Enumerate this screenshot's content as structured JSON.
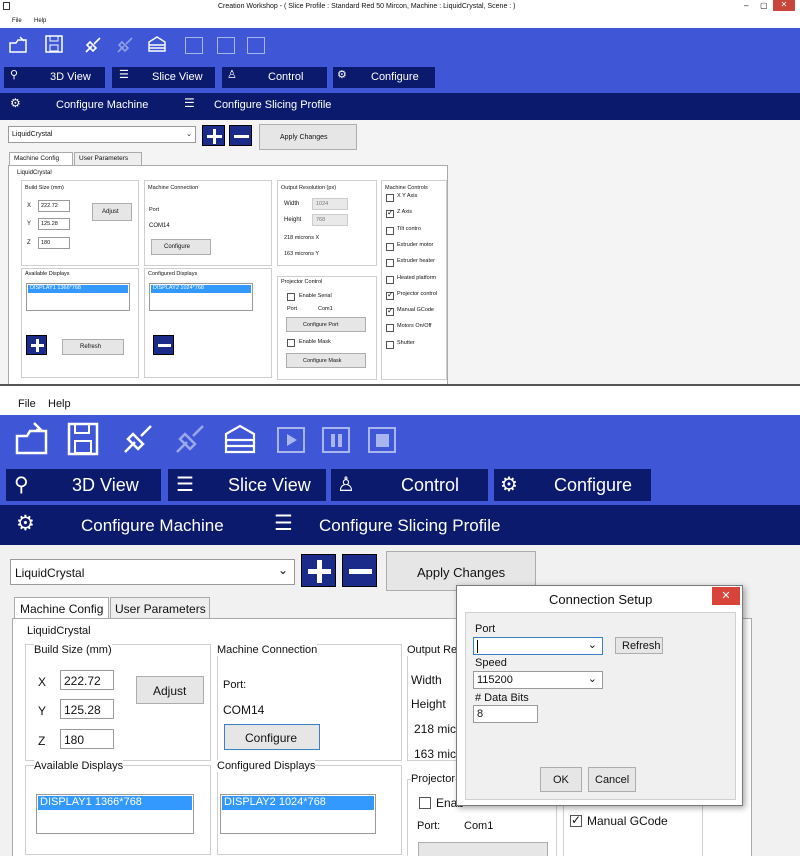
{
  "window": {
    "app_icon": "window-icon",
    "title": "Creation Workshop -  ( Slice Profile : Standard Red 50 Mircon, Machine : LiquidCrystal, Scene : )",
    "min": "–",
    "max": "▢",
    "close": "✕"
  },
  "menu": {
    "file": "File",
    "help": "Help"
  },
  "toolbar": {
    "icons": [
      "open-file-icon",
      "save-icon",
      "connect-icon",
      "disconnect-icon",
      "slice-icon",
      "play-icon",
      "pause-icon",
      "stop-icon"
    ]
  },
  "tabs": {
    "view3d": "3D View",
    "slice_view": "Slice View",
    "control": "Control",
    "configure": "Configure"
  },
  "subtabs": {
    "configure_machine": "Configure Machine",
    "configure_slicing": "Configure Slicing Profile"
  },
  "machine_select": {
    "value": "LiquidCrystal"
  },
  "apply_changes": "Apply Changes",
  "config_tabs": {
    "machine_config": "Machine Config",
    "user_parameters": "User Parameters"
  },
  "machine_name": "LiquidCrystal",
  "build_size": {
    "label": "Build Size (mm)",
    "x_label": "X",
    "x": "222.72",
    "y_label": "Y",
    "y": "125.28",
    "z_label": "Z",
    "z": "180",
    "adjust": "Adjust"
  },
  "machine_connection": {
    "label": "Machine Connection",
    "port_label": "Port:",
    "port_label_small": "Port",
    "port": "COM14",
    "configure": "Configure"
  },
  "output_resolution": {
    "label": "Output Resolution (px)",
    "label_cut": "Output Re",
    "width_label": "Width",
    "width": "1024",
    "height_label": "Height",
    "height": "768",
    "microns_x": "218 microns X",
    "microns_x_cut": "218 micr",
    "microns_y": "163 microns Y",
    "microns_y_cut": "163 micr"
  },
  "machine_controls": {
    "label": "Machine Controls",
    "items": [
      {
        "label": "X Y Axis",
        "checked": false
      },
      {
        "label": "Z Axis",
        "checked": true
      },
      {
        "label": "Tilt contro",
        "checked": false
      },
      {
        "label": "Extruder motor",
        "checked": false
      },
      {
        "label": "Extruder heater",
        "checked": false
      },
      {
        "label": "Heated platform",
        "checked": false
      },
      {
        "label": "Projector control",
        "checked": true
      },
      {
        "label": "Manual GCode",
        "checked": true
      },
      {
        "label": "Motors On/Off",
        "checked": false
      },
      {
        "label": "Shutter",
        "checked": false
      }
    ]
  },
  "available_displays": {
    "label": "Available Displays",
    "items": [
      "DISPLAY1 1366*768"
    ],
    "refresh": "Refresh"
  },
  "configured_displays": {
    "label": "Configured Displays",
    "items": [
      "DISPLAY2 1024*768"
    ]
  },
  "projector_control": {
    "label": "Projector Control",
    "label_cut": "Projector",
    "enable_serial": "Enable Serial",
    "enable_serial_cut": "Enab",
    "port_label": "Port",
    "port_label2": "Port:",
    "port": "Com1",
    "configure_port": "Configure Port",
    "enable_mask": "Enable Mask",
    "configure_mask": "Configure Mask"
  },
  "dialog": {
    "title": "Connection Setup",
    "close": "✕",
    "port_label": "Port",
    "port_value": "",
    "refresh": "Refresh",
    "speed_label": "Speed",
    "speed_value": "115200",
    "databits_label": "# Data Bits",
    "databits_value": "8",
    "ok": "OK",
    "cancel": "Cancel"
  },
  "colors": {
    "toolbar_blue": "#3f56d6",
    "tab_navy": "#0c1a6e",
    "dialog_close": "#d9443a",
    "selection": "#3399ff"
  }
}
